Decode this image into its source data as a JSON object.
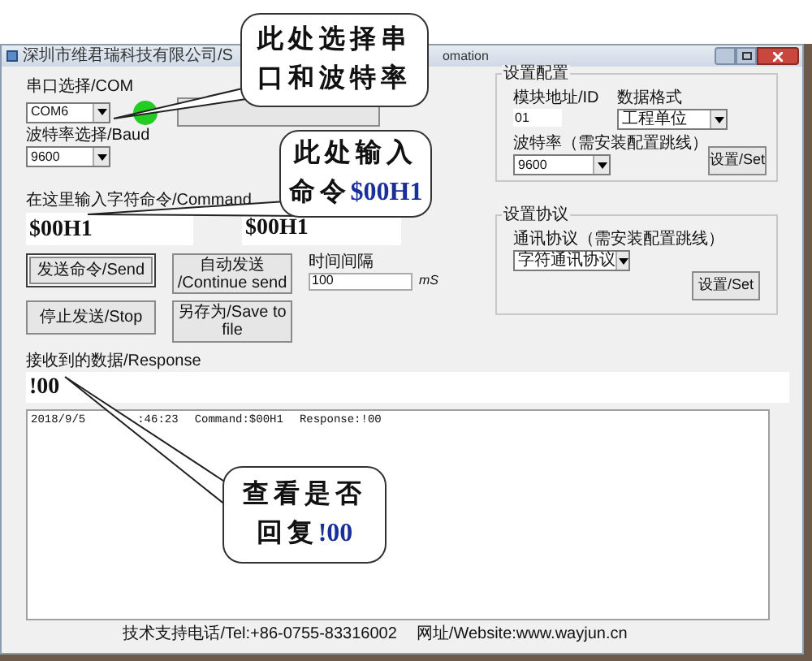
{
  "window": {
    "title": "深圳市维君瑞科技有限公司/S",
    "title_end": "omation"
  },
  "serial": {
    "port_label": "串口选择/COM",
    "port": "COM6",
    "connected": true,
    "baud_label": "波特率选择/Baud",
    "baud": "9600"
  },
  "command": {
    "label": "在这里输入字符命令/Command",
    "value": "$00H1",
    "echo": "$00H1"
  },
  "buttons": [
    {
      "label": "发送命令/Send",
      "focused": true
    },
    {
      "label": "自动发送 /Continue send",
      "focused": false
    },
    {
      "label": "停止发送/Stop",
      "focused": false
    },
    {
      "label": "另存为/Save to file",
      "focused": false
    }
  ],
  "interval": {
    "label": "时间间隔",
    "value": "100",
    "unit": "mS"
  },
  "config": {
    "title": "设置配置",
    "id_label": "模块地址/ID",
    "id": "01",
    "format_label": "数据格式",
    "format": "工程单位",
    "baud_label": "波特率（需安装配置跳线）",
    "baud": "9600",
    "button": "设置/Set"
  },
  "protocol": {
    "title": "设置协议",
    "label": "通讯协议（需安装配置跳线）",
    "value": "字符通讯协议",
    "button": "设置/Set"
  },
  "response": {
    "label": "接收到的数据/Response",
    "value": "!00"
  },
  "log": [
    {
      "date": "2018/9/5",
      "time": ":46:23",
      "command": "Command:$00H1",
      "response": "Response:!00"
    }
  ],
  "footer": {
    "tel": "技术支持电话/Tel:+86-0755-83316002",
    "website": "网址/Website:www.wayjun.cn"
  },
  "callouts": [
    {
      "lines": [
        {
          "text": "此处选择串"
        },
        {
          "text": "口和波特率"
        }
      ]
    },
    {
      "lines": [
        {
          "text": "此处输入"
        },
        {
          "text": "命令",
          "highlight": "$00H1"
        }
      ]
    },
    {
      "lines": [
        {
          "text": "查看是否"
        },
        {
          "text": "回复",
          "highlight": "!00"
        }
      ]
    }
  ]
}
